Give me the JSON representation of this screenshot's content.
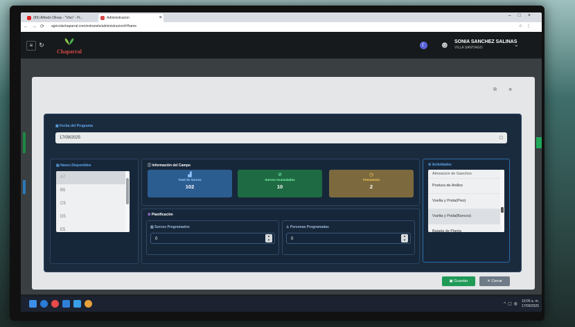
{
  "browser": {
    "tabs": [
      {
        "label": "(89) Alfredo Olivas - \"Vivo\" - Ft...",
        "active": false
      },
      {
        "label": "Administracion",
        "active": true
      }
    ],
    "url": "agricolachaparral.com/extranets/administracion/#/frame"
  },
  "header": {
    "brand": "Chaparral",
    "user_name": "SONIA SANCHEZ SALINAS",
    "user_location": "VILLA SANTIAGO"
  },
  "modal": {
    "fecha": {
      "label": "Fecha del Programa",
      "value": "17/09/2025"
    },
    "naves": {
      "title": "Naves Disponibles",
      "items": [
        "A7",
        "B5",
        "C5",
        "D5",
        "E5"
      ]
    },
    "info": {
      "title": "Información del Campo",
      "cards": [
        {
          "label": "Total de Surcos",
          "value": "102",
          "color": "#2c5d91"
        },
        {
          "label": "Surcos Acumulados",
          "value": "10",
          "color": "#1e6a43"
        },
        {
          "label": "Frecuencia",
          "value": "2",
          "color": "#7c6a3e"
        }
      ]
    },
    "planificacion": {
      "title": "Planificación",
      "surcos_label": "Surcos Programados",
      "surcos_value": "0",
      "personas_label": "Personas Programadas",
      "personas_value": "0"
    },
    "actividades": {
      "title": "Actividades",
      "items": [
        "Almeacion de Ganchos",
        "Postura de Anillos",
        "Vuelta y Poda(Piso)",
        "Vuelta y Poda(Bancos)",
        "Bajada de Planta"
      ]
    },
    "save_label": "Guardar",
    "close_label": "Cerrar"
  },
  "taskbar": {
    "time": "10:05 a. m.",
    "date": "17/09/2025"
  }
}
